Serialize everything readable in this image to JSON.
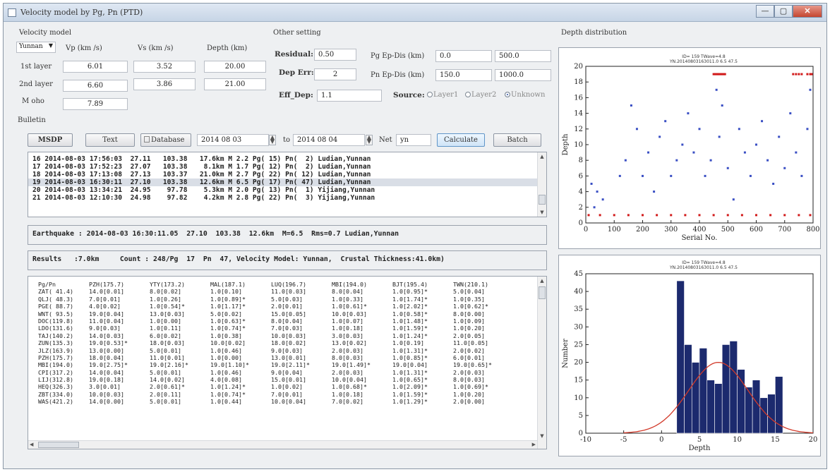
{
  "window": {
    "title": "Velocity model by Pg, Pn (PTD)",
    "min_label": "—",
    "max_label": "▢",
    "close_label": "✕"
  },
  "velocity_model": {
    "group_label": "Velocity model",
    "model_value": "Yunnan",
    "headers": [
      "Vp (km /s)",
      "Vs (km /s)",
      "Depth (km)"
    ],
    "rows": [
      {
        "label": "1st layer",
        "vp": "6.01",
        "vs": "3.52",
        "depth": "20.00"
      },
      {
        "label": "2nd layer",
        "vp": "6.60",
        "vs": "3.86",
        "depth": "21.00"
      },
      {
        "label": "M oho",
        "vp": "7.89",
        "vs": "",
        "depth": ""
      }
    ]
  },
  "other_setting": {
    "group_label": "Other setting",
    "residual_label": "Residual:",
    "residual_value": "0.50",
    "dep_err_label": "Dep Err:",
    "dep_err_value": "2",
    "eff_dep_label": "Eff_Dep:",
    "eff_dep_value": "1.1",
    "pg_label": "Pg Ep-Dis (km)",
    "pg_min": "0.0",
    "pg_max": "500.0",
    "pn_label": "Pn Ep-Dis (km)",
    "pn_min": "150.0",
    "pn_max": "1000.0",
    "source_label": "Source:",
    "source_options": [
      "Layer1",
      "Layer2",
      "Unknown"
    ],
    "source_selected": "Unknown"
  },
  "bulletin": {
    "group_label": "Bulletin",
    "msdp_label": "MSDP",
    "text_label": "Text",
    "database_label": "Database",
    "date_from": "2014 08 03",
    "to_label": "to",
    "date_to": "2014 08 04",
    "net_label": "Net",
    "net_value": "yn",
    "calculate_label": "Calculate",
    "batch_label": "Batch",
    "events": [
      {
        "text": "16 2014-08-03 17:56:03  27.11   103.38   17.6km M 2.2 Pg( 15) Pn(  2) Ludian,Yunnan",
        "selected": false
      },
      {
        "text": "17 2014-08-03 17:52:23  27.07   103.38    8.1km M 1.7 Pg( 12) Pn(  2) Ludian,Yunnan",
        "selected": false
      },
      {
        "text": "18 2014-08-03 17:13:08  27.13   103.37   21.0km M 2.7 Pg( 22) Pn( 12) Ludian,Yunnan",
        "selected": false
      },
      {
        "text": "19 2014-08-03 16:30:11  27.10   103.38   12.6km M 6.5 Pg( 17) Pn( 47) Ludian,Yunnan",
        "selected": true
      },
      {
        "text": "20 2014-08-03 13:34:21  24.95    97.78    5.3km M 2.0 Pg( 13) Pn(  1) Yijiang,Yunnan",
        "selected": false
      },
      {
        "text": "21 2014-08-03 12:10:30  24.98    97.82    4.2km M 2.8 Pg( 22) Pn(  3) Yijiang,Yunnan",
        "selected": false
      }
    ]
  },
  "earthquake_line": "Earthquake : 2014-08-03 16:30:11.05  27.10  103.38  12.6km  M=6.5  Rms=0.7 Ludian,Yunnan",
  "results_line": "Results   :7.0km     Count : 248/Pg  17  Pn  47, Velocity Model: Yunnan,  Crustal Thickness:41.0km)",
  "results_table": {
    "columns": [
      "Pg/Pn",
      "PZH(175.7)",
      "YTY(173.2)",
      "MAL(187.1)",
      "LUQ(196.7)",
      "MBI(194.0)",
      "BJT(195.4)",
      "TWN(210.1)"
    ],
    "rows": [
      [
        "ZAT( 41.4)",
        "14.0[0.01]",
        "8.0[0.02]",
        "1.0[0.10]",
        "11.0[0.03]",
        "8.0[0.04]",
        "1.0[0.95]*",
        "5.0[0.04]"
      ],
      [
        "QLJ( 48.3)",
        "7.0[0.01]",
        "1.0[0.26]",
        "1.0[0.89]*",
        "5.0[0.03]",
        "1.0[0.33]",
        "1.0[1.74]*",
        "1.0[0.35]"
      ],
      [
        "PGE( 88.7)",
        "4.0[0.02]",
        "1.0[0.54]*",
        "1.0[1.17]*",
        "2.0[0.01]",
        "1.0[0.61]*",
        "1.0[2.02]*",
        "1.0[0.62]*"
      ],
      [
        "WNT( 93.5)",
        "19.0[0.04]",
        "13.0[0.03]",
        "5.0[0.02]",
        "15.0[0.05]",
        "10.0[0.03]",
        "1.0[0.58]*",
        "8.0[0.00]"
      ],
      [
        "DOC(119.8)",
        "11.0[0.04]",
        "1.0[0.00]",
        "1.0[0.63]*",
        "8.0[0.04]",
        "1.0[0.07]",
        "1.0[1.48]*",
        "1.0[0.09]"
      ],
      [
        "LDO(131.6)",
        "9.0[0.03]",
        "1.0[0.11]",
        "1.0[0.74]*",
        "7.0[0.03]",
        "1.0[0.18]",
        "1.0[1.59]*",
        "1.0[0.20]"
      ],
      [
        "TAJ(140.2)",
        "14.0[0.03]",
        "6.0[0.02]",
        "1.0[0.38]",
        "10.0[0.03]",
        "3.0[0.03]",
        "1.0[1.24]*",
        "2.0[0.05]"
      ],
      [
        "ZUN(135.3)",
        "19.0[0.53]*",
        "18.0[0.03]",
        "10.0[0.02]",
        "18.0[0.02]",
        "13.0[0.02]",
        "1.0[0.19]",
        "11.0[0.05]"
      ],
      [
        "JLZ(163.9)",
        "13.0[0.00]",
        "5.0[0.01]",
        "1.0[0.46]",
        "9.0[0.03]",
        "2.0[0.03]",
        "1.0[1.31]*",
        "2.0[0.02]"
      ],
      [
        "PZH(175.7)",
        "18.0[0.04]",
        "11.0[0.01]",
        "1.0[0.00]",
        "13.0[0.01]",
        "8.0[0.03]",
        "1.0[0.85]*",
        "6.0[0.01]"
      ],
      [
        "MBI(194.0)",
        "19.0[2.75]*",
        "19.0[2.16]*",
        "19.0[1.10]*",
        "19.0[2.11]*",
        "19.0[1.49]*",
        "19.0[0.04]",
        "19.0[0.65]*"
      ],
      [
        "CPI(317.2)",
        "14.0[0.04]",
        "5.0[0.01]",
        "1.0[0.46]",
        "9.0[0.04]",
        "2.0[0.03]",
        "1.0[1.31]*",
        "2.0[0.03]"
      ],
      [
        "LIJ(312.8)",
        "19.0[0.18]",
        "14.0[0.02]",
        "4.0[0.08]",
        "15.0[0.01]",
        "10.0[0.04]",
        "1.0[0.65]*",
        "8.0[0.03]"
      ],
      [
        "HEQ(326.3)",
        "3.0[0.01]",
        "2.0[0.61]*",
        "1.0[1.24]*",
        "1.0[0.02]",
        "1.0[0.68]*",
        "1.0[2.09]*",
        "1.0[0.69]*"
      ],
      [
        "ZBT(334.0)",
        "10.0[0.03]",
        "2.0[0.11]",
        "1.0[0.74]*",
        "7.0[0.01]",
        "1.0[0.18]",
        "1.0[1.59]*",
        "1.0[0.20]"
      ],
      [
        "WAS(421.2)",
        "14.0[0.00]",
        "5.0[0.01]",
        "1.0[0.44]",
        "10.0[0.04]",
        "7.0[0.02]",
        "1.0[1.29]*",
        "2.0[0.00]"
      ]
    ]
  },
  "depth_distribution": {
    "group_label": "Depth distribution",
    "scatter_subtitle": "ID= 159  TWave=4.8",
    "scatter_subtitle2": "YN.20140803163011.0  6.5  47.5",
    "hist_subtitle": "ID= 159  TWave=4.8",
    "hist_subtitle2": "YN.20140803163011.0  6.5  47.5"
  },
  "chart_data": [
    {
      "type": "scatter",
      "xlabel": "Serial No.",
      "ylabel": "Depth",
      "xlim": [
        0,
        800
      ],
      "ylim": [
        0,
        20
      ],
      "x_ticks": [
        0,
        100,
        200,
        300,
        400,
        500,
        600,
        700,
        800
      ],
      "y_ticks": [
        0,
        2,
        4,
        6,
        8,
        10,
        12,
        14,
        16,
        18,
        20
      ],
      "series": [
        {
          "color": "#d11a1a",
          "points": [
            [
              460,
              19
            ],
            [
              465,
              19
            ],
            [
              470,
              19
            ],
            [
              475,
              19
            ],
            [
              480,
              19
            ],
            [
              485,
              19
            ],
            [
              490,
              19
            ],
            [
              455,
              19
            ],
            [
              450,
              19
            ],
            [
              730,
              19
            ],
            [
              740,
              19
            ],
            [
              750,
              19
            ],
            [
              760,
              19
            ],
            [
              780,
              19
            ],
            [
              790,
              19
            ],
            [
              795,
              19
            ],
            [
              10,
              1
            ],
            [
              50,
              1
            ],
            [
              100,
              1
            ],
            [
              150,
              1
            ],
            [
              200,
              1
            ],
            [
              250,
              1
            ],
            [
              300,
              1
            ],
            [
              350,
              1
            ],
            [
              400,
              1
            ],
            [
              450,
              1
            ],
            [
              500,
              1
            ],
            [
              550,
              1
            ],
            [
              600,
              1
            ],
            [
              650,
              1
            ],
            [
              700,
              1
            ],
            [
              750,
              1
            ],
            [
              790,
              1
            ]
          ]
        },
        {
          "color": "#3a4fc4",
          "points": [
            [
              20,
              5
            ],
            [
              40,
              4
            ],
            [
              30,
              2
            ],
            [
              60,
              3
            ],
            [
              120,
              6
            ],
            [
              140,
              8
            ],
            [
              160,
              15
            ],
            [
              180,
              12
            ],
            [
              200,
              6
            ],
            [
              220,
              9
            ],
            [
              240,
              4
            ],
            [
              260,
              11
            ],
            [
              280,
              13
            ],
            [
              300,
              6
            ],
            [
              320,
              8
            ],
            [
              340,
              10
            ],
            [
              360,
              14
            ],
            [
              380,
              9
            ],
            [
              400,
              12
            ],
            [
              420,
              6
            ],
            [
              440,
              8
            ],
            [
              460,
              17
            ],
            [
              470,
              11
            ],
            [
              480,
              15
            ],
            [
              500,
              7
            ],
            [
              520,
              3
            ],
            [
              540,
              12
            ],
            [
              560,
              9
            ],
            [
              580,
              6
            ],
            [
              600,
              10
            ],
            [
              620,
              13
            ],
            [
              640,
              8
            ],
            [
              660,
              5
            ],
            [
              680,
              11
            ],
            [
              700,
              7
            ],
            [
              720,
              14
            ],
            [
              740,
              9
            ],
            [
              760,
              6
            ],
            [
              780,
              12
            ],
            [
              790,
              17
            ]
          ]
        }
      ]
    },
    {
      "type": "bar",
      "xlabel": "Depth",
      "ylabel": "Number",
      "xlim": [
        -10,
        20
      ],
      "ylim": [
        0,
        45
      ],
      "x_ticks": [
        -10,
        -5,
        0,
        5,
        10,
        15,
        20
      ],
      "y_ticks": [
        0,
        5,
        10,
        15,
        20,
        25,
        30,
        35,
        40,
        45
      ],
      "bins": [
        2,
        3,
        4,
        5,
        6,
        7,
        8,
        9,
        10,
        11,
        12,
        13,
        14,
        15
      ],
      "values": [
        43,
        25,
        20,
        24,
        15,
        14,
        25,
        26,
        18,
        13,
        15,
        10,
        11,
        16
      ],
      "normal_fit": {
        "mean": 7.5,
        "std": 3.9,
        "peak": 20
      }
    }
  ]
}
